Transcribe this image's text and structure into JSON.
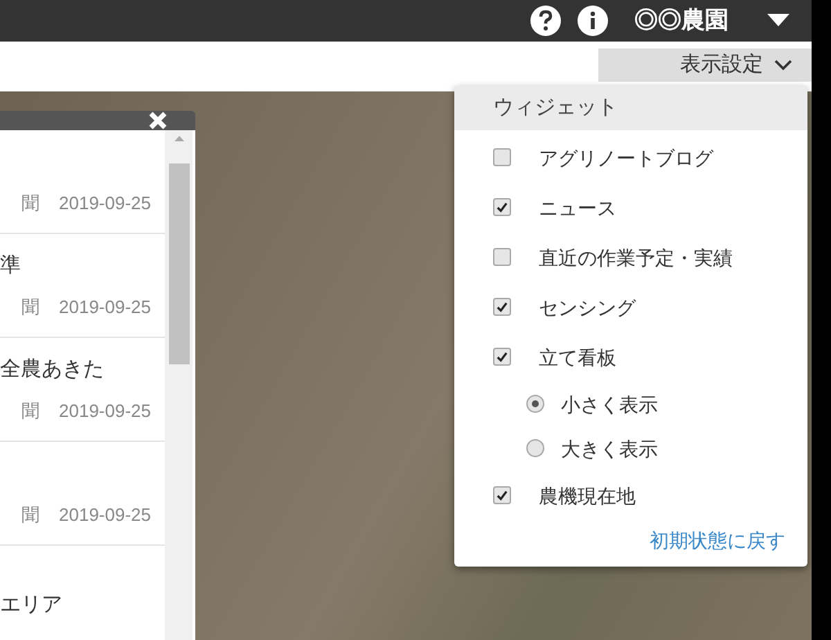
{
  "top_bar": {
    "farm_name": "◎◎農園"
  },
  "display_settings": {
    "label": "表示設定"
  },
  "news_panel": {
    "items": [
      {
        "source": "聞",
        "date": "2019-09-25"
      },
      {
        "title": "準",
        "source": "聞",
        "date": "2019-09-25"
      },
      {
        "title": "全農あきた",
        "source": "聞",
        "date": "2019-09-25"
      },
      {
        "source": "聞",
        "date": "2019-09-25"
      },
      {
        "title": "エリア"
      }
    ]
  },
  "widget_menu": {
    "heading": "ウィジェット",
    "items": [
      {
        "kind": "checkbox",
        "label": "アグリノートブログ",
        "checked": false
      },
      {
        "kind": "checkbox",
        "label": "ニュース",
        "checked": true
      },
      {
        "kind": "checkbox",
        "label": "直近の作業予定・実績",
        "checked": false
      },
      {
        "kind": "checkbox",
        "label": "センシング",
        "checked": true
      },
      {
        "kind": "checkbox",
        "label": "立て看板",
        "checked": true
      },
      {
        "kind": "radio",
        "label": "小さく表示",
        "selected": true
      },
      {
        "kind": "radio",
        "label": "大きく表示",
        "selected": false
      },
      {
        "kind": "checkbox",
        "label": "農機現在地",
        "checked": true
      }
    ],
    "reset_link": "初期状態に戻す"
  }
}
